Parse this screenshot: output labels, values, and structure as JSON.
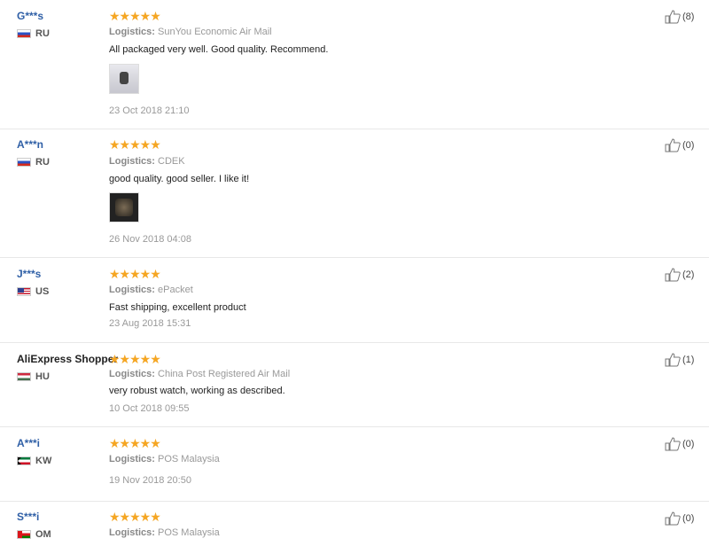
{
  "reviews": [
    {
      "name": "G***s",
      "country": "RU",
      "flag": "ru",
      "stars": "★★★★★",
      "logistics_label": "Logistics:",
      "logistics": "SunYou Economic Air Mail",
      "text": "All packaged very well. Good quality. Recommend.",
      "has_photo": true,
      "date": "23 Oct 2018 21:10",
      "likes": "(8)"
    },
    {
      "name": "A***n",
      "country": "RU",
      "flag": "ru",
      "stars": "★★★★★",
      "logistics_label": "Logistics:",
      "logistics": "CDEK",
      "text": "good quality. good seller. I like it!",
      "has_photo": true,
      "date": "26 Nov 2018 04:08",
      "likes": "(0)"
    },
    {
      "name": "J***s",
      "country": "US",
      "flag": "us",
      "stars": "★★★★★",
      "logistics_label": "Logistics:",
      "logistics": "ePacket",
      "text": "Fast shipping, excellent product",
      "has_photo": false,
      "date": "23 Aug 2018 15:31",
      "likes": "(2)"
    },
    {
      "name": "AliExpress Shopper",
      "country": "HU",
      "flag": "hu",
      "stars": "★★★★★",
      "logistics_label": "Logistics:",
      "logistics": "China Post Registered Air Mail",
      "text": "very robust watch, working as described.",
      "has_photo": false,
      "date": "10 Oct 2018 09:55",
      "likes": "(1)"
    },
    {
      "name": "A***i",
      "country": "KW",
      "flag": "kw",
      "stars": "★★★★★",
      "logistics_label": "Logistics:",
      "logistics": "POS Malaysia",
      "text": "",
      "has_photo": false,
      "date": "19 Nov 2018 20:50",
      "likes": "(0)"
    },
    {
      "name": "S***i",
      "country": "OM",
      "flag": "om",
      "stars": "★★★★★",
      "logistics_label": "Logistics:",
      "logistics": "POS Malaysia",
      "text": "",
      "has_photo": false,
      "date": "",
      "likes": "(0)"
    }
  ]
}
